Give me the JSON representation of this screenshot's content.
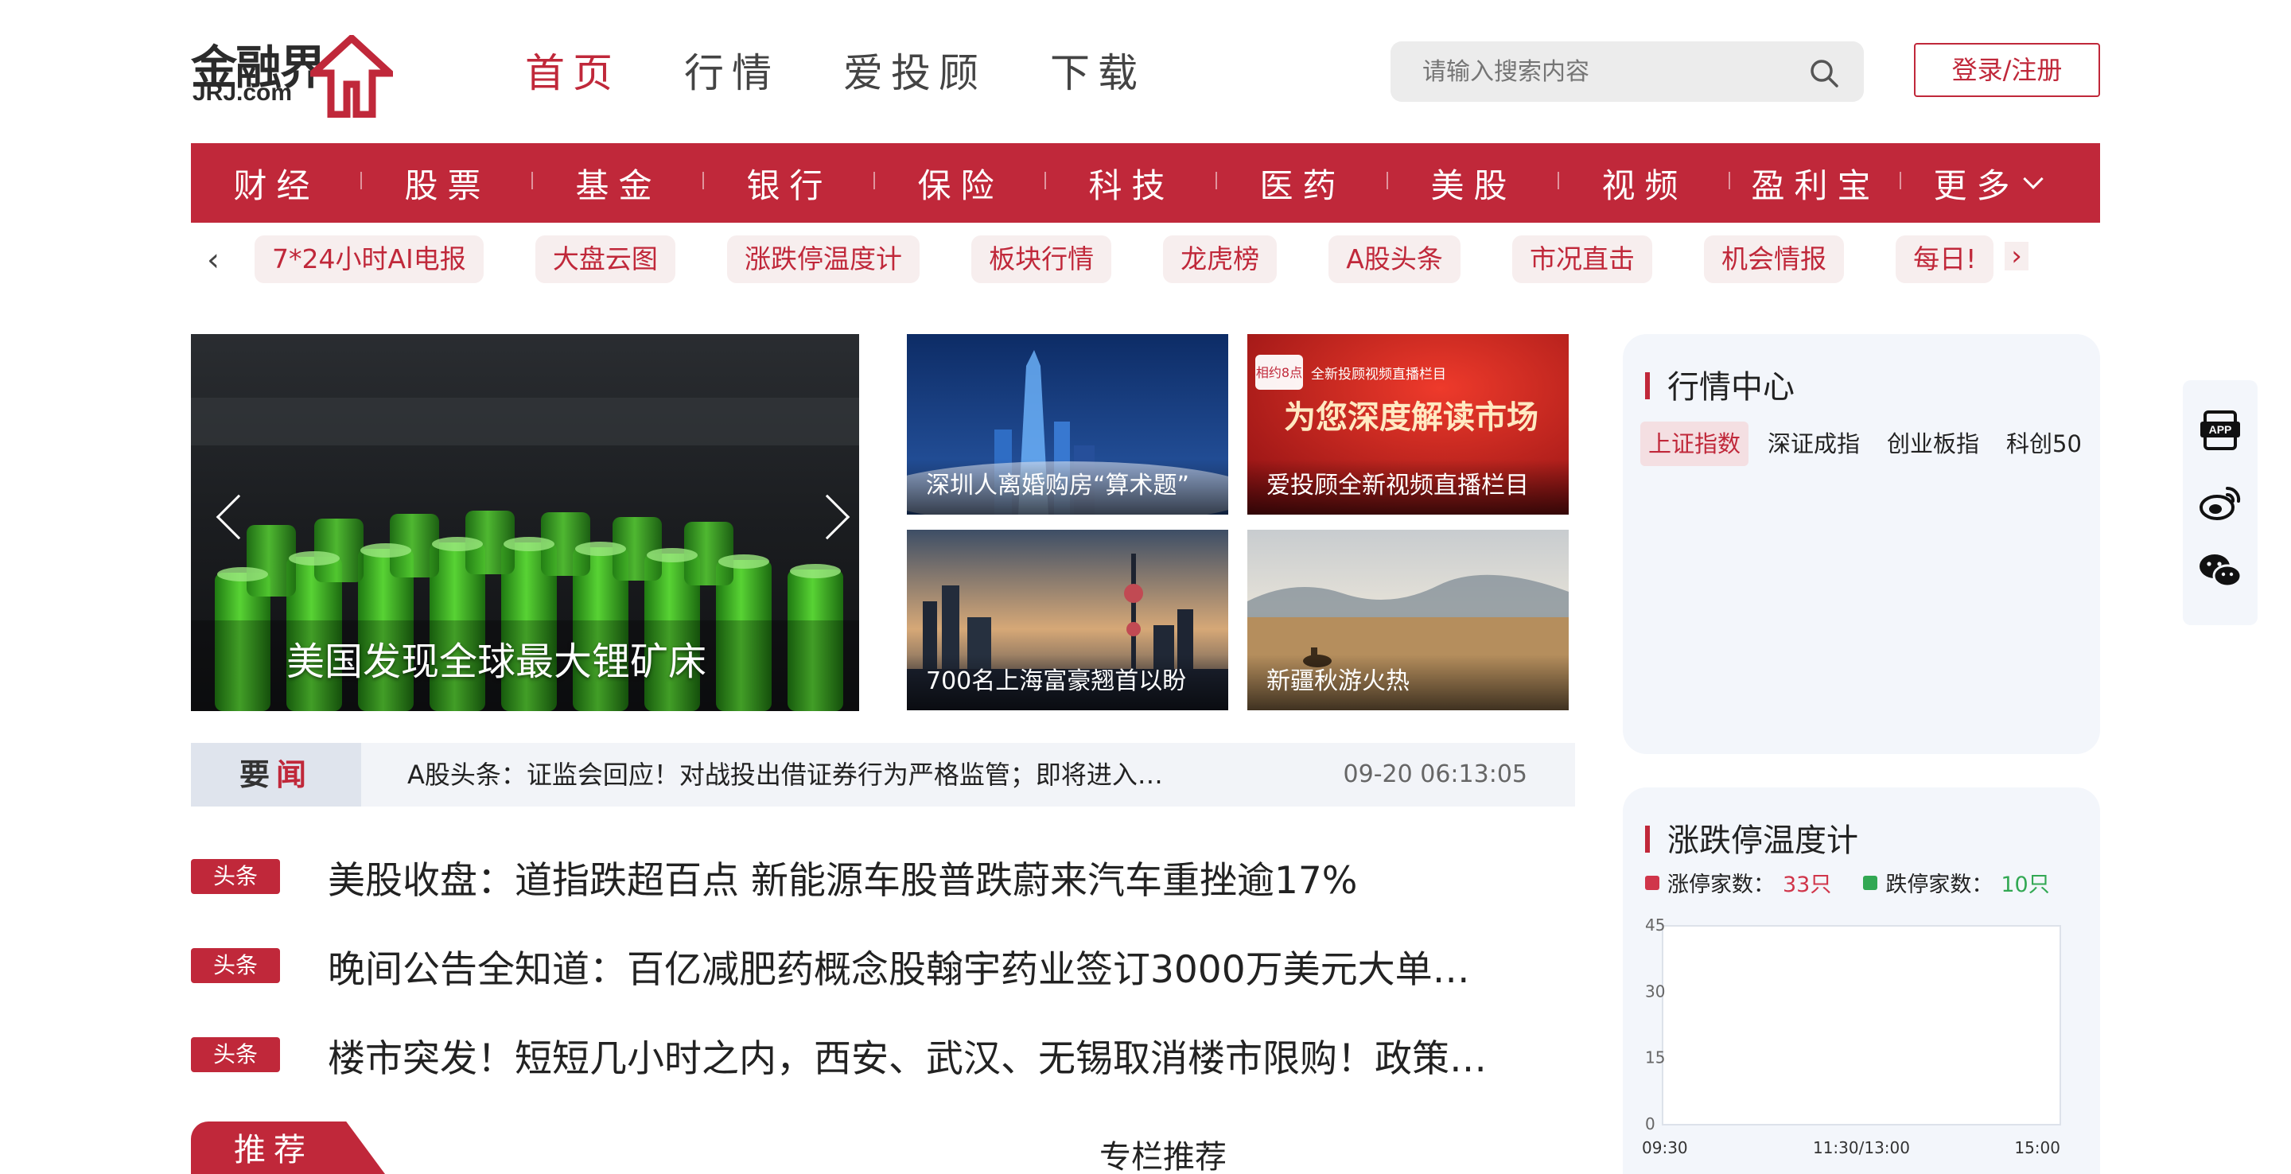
{
  "logo": {
    "cn": "金融界",
    "en": "JRJ.com"
  },
  "top_nav": [
    {
      "label": "首页",
      "active": true
    },
    {
      "label": "行情",
      "active": false
    },
    {
      "label": "爱投顾",
      "active": false
    },
    {
      "label": "下载",
      "active": false
    }
  ],
  "search": {
    "placeholder": "请输入搜索内容"
  },
  "login": {
    "label": "登录/注册"
  },
  "categories": [
    "财经",
    "股票",
    "基金",
    "银行",
    "保险",
    "科技",
    "医药",
    "美股",
    "视频",
    "盈利宝",
    "更多"
  ],
  "tags": [
    "7*24小时AI电报",
    "大盘云图",
    "涨跌停温度计",
    "板块行情",
    "龙虎榜",
    "A股头条",
    "市况直击",
    "机会情报",
    "每日!"
  ],
  "carousel": {
    "caption": "美国发现全球最大锂矿床"
  },
  "thumbs": [
    {
      "caption": "深圳人离婚购房“算术题”"
    },
    {
      "caption": "爱投顾全新视频直播栏目",
      "banner_small": "全新投顾视频直播栏目",
      "banner_big": "为您深度解读市场",
      "banner_logo": "相约8点"
    },
    {
      "caption": "700名上海富豪翘首以盼"
    },
    {
      "caption": "新疆秋游火热"
    }
  ],
  "ticker": {
    "label_1": "要",
    "label_2": "闻",
    "text": "A股头条：证监会回应！对战投出借证券行为严格监管；即将进入…",
    "time": "09-20 06:13:05"
  },
  "headlines": [
    {
      "badge": "头条",
      "text": "美股收盘：道指跌超百点 新能源车股普跌蔚来汽车重挫逾17%"
    },
    {
      "badge": "头条",
      "text": "晚间公告全知道：百亿减肥药概念股翰宇药业签订3000万美元大单…"
    },
    {
      "badge": "头条",
      "text": "楼市突发！短短几小时之内，西安、武汉、无锡取消楼市限购！政策…"
    }
  ],
  "recommend_tab": "推荐",
  "column_title": "专栏推荐",
  "market_center": {
    "title": "行情中心",
    "tabs": [
      {
        "label": "上证指数",
        "active": true
      },
      {
        "label": "深证成指",
        "active": false
      },
      {
        "label": "创业板指",
        "active": false
      },
      {
        "label": "科创50",
        "active": false
      }
    ]
  },
  "limit_thermo": {
    "title": "涨跌停温度计",
    "up_label": "涨停家数：",
    "up_value": "33只",
    "down_label": "跌停家数：",
    "down_value": "10只"
  },
  "chart_data": {
    "type": "line",
    "title": "",
    "x_ticks": [
      "09:30",
      "11:30/13:00",
      "15:00"
    ],
    "y_ticks": [
      0,
      15,
      30,
      45
    ],
    "ylim": [
      0,
      45
    ],
    "series": [],
    "grid": false
  },
  "side_icons": [
    "app-icon",
    "weibo-icon",
    "wechat-icon"
  ],
  "colors": {
    "brand_red": "#c0283a",
    "up_red": "#d0354a",
    "down_green": "#32a853",
    "panel_bg": "#f3f6fb"
  }
}
